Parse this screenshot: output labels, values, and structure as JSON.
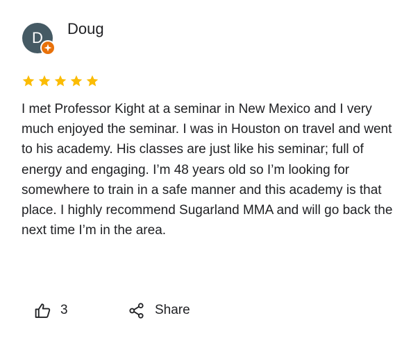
{
  "reviewer": {
    "name": "Doug",
    "avatar_letter": "D",
    "avatar_color": "#455a64",
    "badge_icon": "local-guide-icon",
    "badge_color": "#e8710a"
  },
  "rating": {
    "value": 5,
    "max": 5,
    "star_color": "#fbbc04"
  },
  "review": {
    "text": "I met Professor Kight at a seminar in New Mexico and I very much enjoyed the seminar. I was in Houston on travel and went to his academy. His classes are just like his seminar; full of energy and engaging. I’m 48 years old so I’m looking for somewhere to train in a safe manner and this academy is that place. I highly recommend Sugarland MMA and will go back the next time I’m in the area."
  },
  "actions": {
    "like_icon": "thumbs-up-icon",
    "like_count": "3",
    "share_icon": "share-icon",
    "share_label": "Share"
  }
}
